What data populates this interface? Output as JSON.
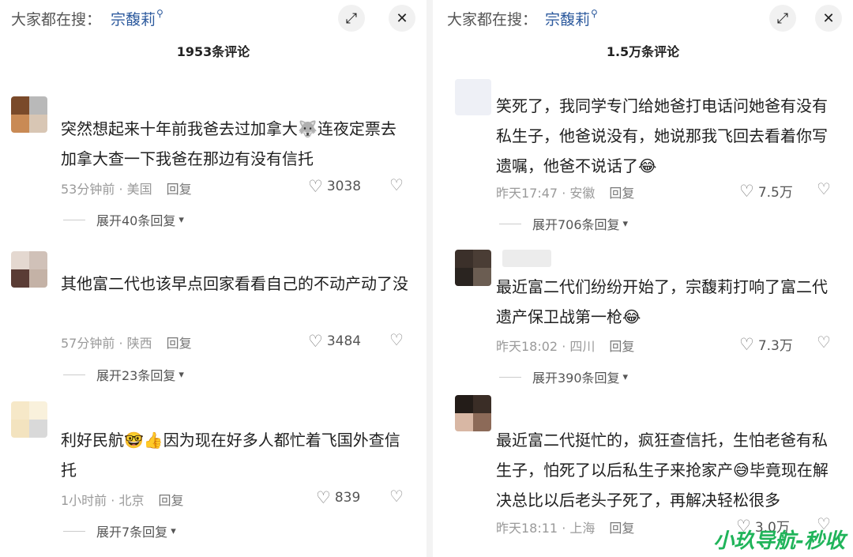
{
  "left": {
    "search_prefix": "大家都在搜：",
    "search_term": "宗馥莉",
    "comment_count": "1953条评论",
    "comments": [
      {
        "text": "突然想起来十年前我爸去过加拿大🐺连夜定票去加拿大查一下我爸在那边有没有信托",
        "time": "53分钟前 · 美国",
        "reply": "回复",
        "likes": "3038",
        "expand": "展开40条回复"
      },
      {
        "text": "其他富二代也该早点回家看看自己的不动产动了没",
        "time": "57分钟前 · 陕西",
        "reply": "回复",
        "likes": "3484",
        "expand": "展开23条回复"
      },
      {
        "text": "利好民航🤓👍因为现在好多人都忙着飞国外查信托",
        "time": "1小时前 · 北京",
        "reply": "回复",
        "likes": "839",
        "expand": "展开7条回复"
      }
    ]
  },
  "right": {
    "search_prefix": "大家都在搜：",
    "search_term": "宗馥莉",
    "comment_count": "1.5万条评论",
    "comments": [
      {
        "text": "笑死了，我同学专门给她爸打电话问她爸有没有私生子，他爸说没有，她说那我飞回去看着你写遗嘱，他爸不说话了😂",
        "time": "昨天17:47 · 安徽",
        "reply": "回复",
        "likes": "7.5万",
        "expand": "展开706条回复"
      },
      {
        "text": "最近富二代们纷纷开始了，宗馥莉打响了富二代遗产保卫战第一枪😂",
        "time": "昨天18:02 · 四川",
        "reply": "回复",
        "likes": "7.3万",
        "expand": "展开390条回复"
      },
      {
        "text": "最近富二代挺忙的，疯狂查信托，生怕老爸有私生子，怕死了以后私生子来抢家产😅毕竟现在解决总比以后老头子死了，再解决轻松很多",
        "time": "昨天18:11 · 上海",
        "reply": "回复",
        "likes": "3.0万",
        "expand": ""
      }
    ]
  },
  "icons": {
    "search": "🔍",
    "expand_screen": "⤢",
    "close": "✕",
    "heart": "♡",
    "dislike": "♡",
    "chevron": "⌄"
  },
  "watermark": "小玖导航-秒收"
}
